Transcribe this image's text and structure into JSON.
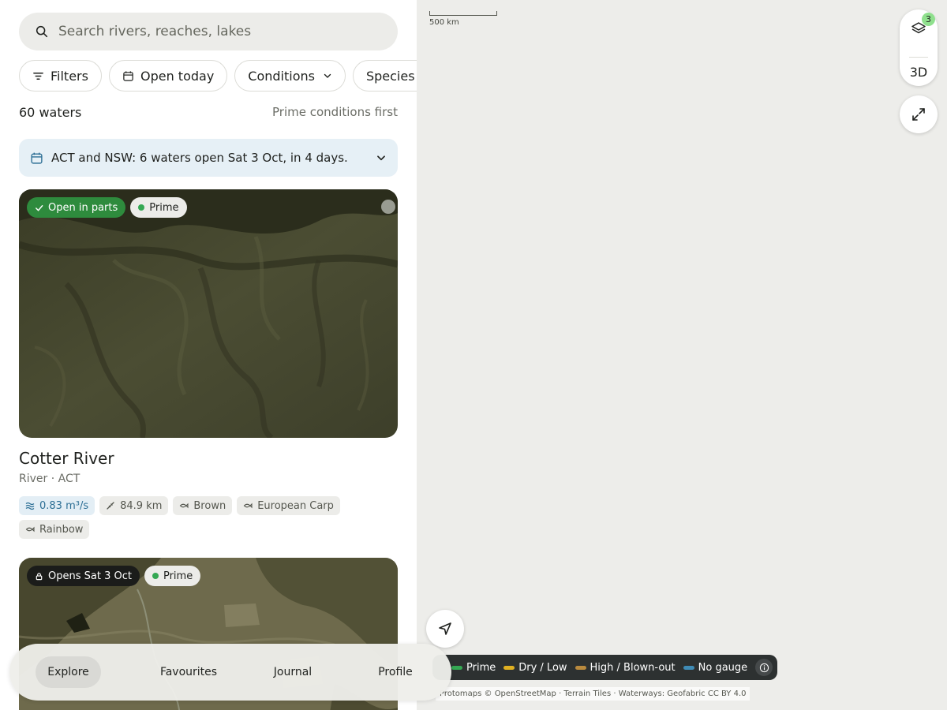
{
  "search": {
    "placeholder": "Search rivers, reaches, lakes",
    "icon": "search-icon"
  },
  "filter_chips": [
    {
      "label": "Filters",
      "icon": "filter-icon"
    },
    {
      "label": "Open today",
      "icon": "calendar-icon"
    },
    {
      "label": "Conditions",
      "icon": "chevron-down-icon"
    },
    {
      "label": "Species",
      "icon": "chevron-down-icon"
    }
  ],
  "results": {
    "count": "60 waters",
    "sort": "Prime conditions first"
  },
  "banner": {
    "text": "ACT and NSW: 6 waters open Sat 3 Oct, in 4 days."
  },
  "cards": [
    {
      "status": "Open in parts",
      "status_icon": "check-icon",
      "condition": "Prime",
      "condition_color": "#34a853",
      "title": "Cotter River",
      "subtitle": "River · ACT",
      "tags": [
        {
          "label": "0.83 m³/s",
          "icon": "flow-icon"
        },
        {
          "label": "84.9 km",
          "icon": "ruler-icon"
        },
        {
          "label": "Brown",
          "icon": "fish-icon"
        },
        {
          "label": "European Carp",
          "icon": "fish-icon"
        },
        {
          "label": "Rainbow",
          "icon": "fish-icon"
        }
      ]
    },
    {
      "status": "Opens Sat 3 Oct",
      "status_icon": "lock-icon",
      "condition": "Prime",
      "condition_color": "#34a853"
    }
  ],
  "map": {
    "scale_label": "500 km",
    "layers_count": "3",
    "mode_3d": "3D",
    "legend": [
      {
        "label": "Prime",
        "color": "#34a853"
      },
      {
        "label": "Dry / Low",
        "color": "#e0b021"
      },
      {
        "label": "High / Blown-out",
        "color": "#b98a3e"
      },
      {
        "label": "No gauge",
        "color": "#3f8bb5"
      }
    ],
    "attribution": "Protomaps © OpenStreetMap · Terrain Tiles · Waterways: Geofabric CC BY 4.0"
  },
  "nav": {
    "tabs": [
      "Explore",
      "Favourites",
      "Journal",
      "Profile"
    ],
    "active": "Explore"
  },
  "colors": {
    "accent_green": "#2e8b3d",
    "banner_bg": "#e6f0f6",
    "flow_blue": "#2d6f95"
  }
}
